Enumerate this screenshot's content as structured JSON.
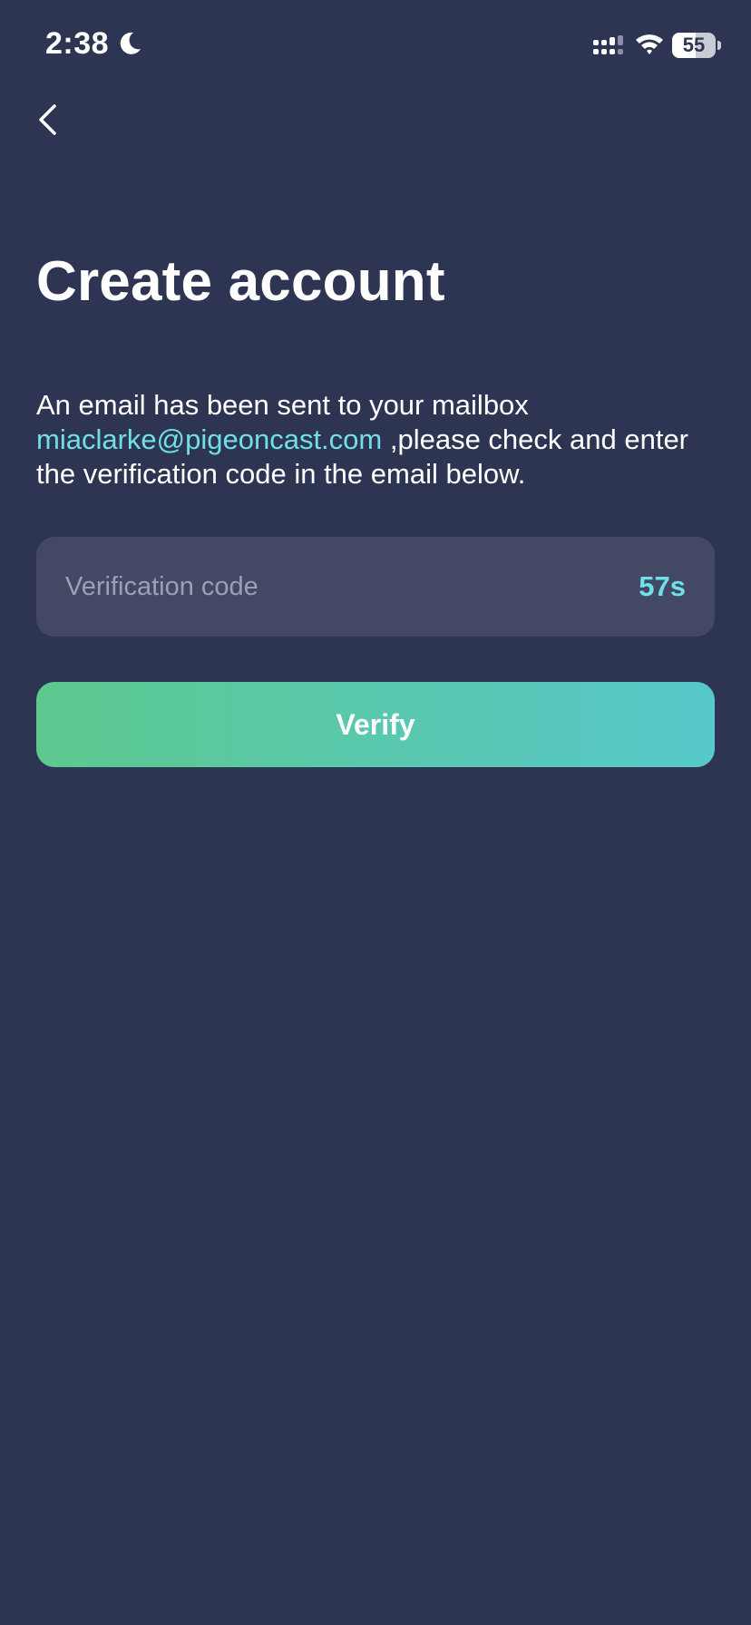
{
  "status_bar": {
    "time": "2:38",
    "battery_level": "55",
    "battery_fraction": 0.55,
    "icons": [
      "moon-icon",
      "signal-icon",
      "wifi-icon",
      "battery-icon"
    ]
  },
  "nav": {
    "back_icon": "chevron-left-icon"
  },
  "page": {
    "title": "Create account",
    "message_before": "An email has been sent to your mailbox ",
    "email": "miaclarke@pigeoncast.com",
    "message_after": " ,please check and enter the verification code in the email below."
  },
  "form": {
    "code_placeholder": "Verification code",
    "code_value": "",
    "countdown": "57s",
    "verify_label": "Verify"
  },
  "colors": {
    "background": "#2e3552",
    "field": "#434965",
    "accent": "#6fe0e8",
    "button_gradient_start": "#5dc98f",
    "button_gradient_end": "#57c8cb"
  }
}
